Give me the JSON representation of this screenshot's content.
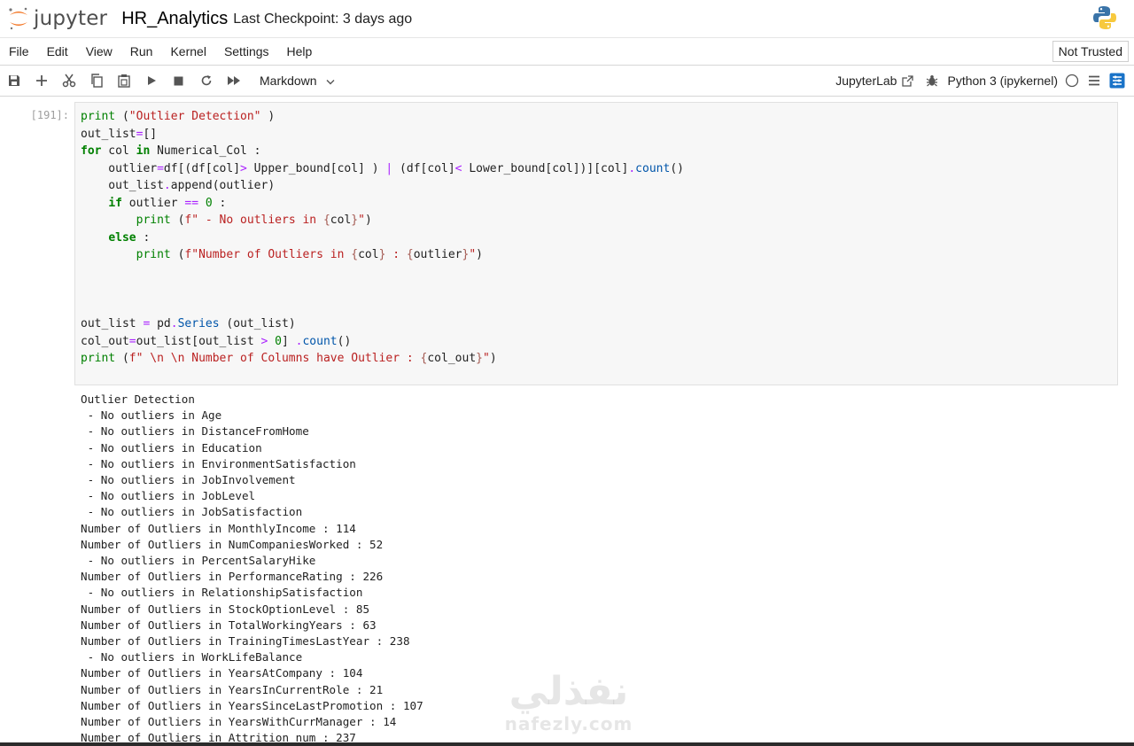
{
  "header": {
    "logo_text": "jupyter",
    "notebook_title": "HR_Analytics",
    "checkpoint": "Last Checkpoint: 3 days ago"
  },
  "menu": [
    "File",
    "Edit",
    "View",
    "Run",
    "Kernel",
    "Settings",
    "Help"
  ],
  "trust_status": "Not Trusted",
  "toolbar": {
    "cell_type": "Markdown",
    "jupyterlab_label": "JupyterLab",
    "kernel_name": "Python 3 (ipykernel)",
    "icons": [
      "save-icon",
      "plus-icon",
      "scissors-icon",
      "copy-icon",
      "paste-icon",
      "play-icon",
      "stop-icon",
      "restart-icon",
      "fast-forward-icon"
    ]
  },
  "cell": {
    "prompt": "[191]:",
    "code_lines": [
      "print (\"Outlier Detection\" )",
      "out_list=[]",
      "for col in Numerical_Col :",
      "    outlier=df[(df[col]> Upper_bound[col] ) | (df[col]< Lower_bound[col])][col].count()",
      "    out_list.append(outlier)",
      "    if outlier == 0 :",
      "        print (f\" - No outliers in {col}\")",
      "    else :",
      "        print (f\"Number of Outliers in {col} : {outlier}\")",
      "",
      "",
      "",
      "out_list = pd.Series (out_list)",
      "col_out=out_list[out_list > 0] .count()",
      "print (f\" \\n \\n Number of Columns have Outlier : {col_out}\")"
    ],
    "output_lines": [
      "Outlier Detection",
      " - No outliers in Age",
      " - No outliers in DistanceFromHome",
      " - No outliers in Education",
      " - No outliers in EnvironmentSatisfaction",
      " - No outliers in JobInvolvement",
      " - No outliers in JobLevel",
      " - No outliers in JobSatisfaction",
      "Number of Outliers in MonthlyIncome : 114",
      "Number of Outliers in NumCompaniesWorked : 52",
      " - No outliers in PercentSalaryHike",
      "Number of Outliers in PerformanceRating : 226",
      " - No outliers in RelationshipSatisfaction",
      "Number of Outliers in StockOptionLevel : 85",
      "Number of Outliers in TotalWorkingYears : 63",
      "Number of Outliers in TrainingTimesLastYear : 238",
      " - No outliers in WorkLifeBalance",
      "Number of Outliers in YearsAtCompany : 104",
      "Number of Outliers in YearsInCurrentRole : 21",
      "Number of Outliers in YearsSinceLastPromotion : 107",
      "Number of Outliers in YearsWithCurrManager : 14",
      "Number of Outliers in Attrition_num : 237"
    ]
  },
  "watermark": {
    "arabic": "نفذلي",
    "latin": "nafezly.com"
  },
  "colors": {
    "jupyter_orange": "#f37726",
    "keyword": "#008000",
    "string": "#ba2121",
    "operator": "#aa22ff",
    "attribute": "#0055aa",
    "cell_bg": "#f7f7f7"
  }
}
